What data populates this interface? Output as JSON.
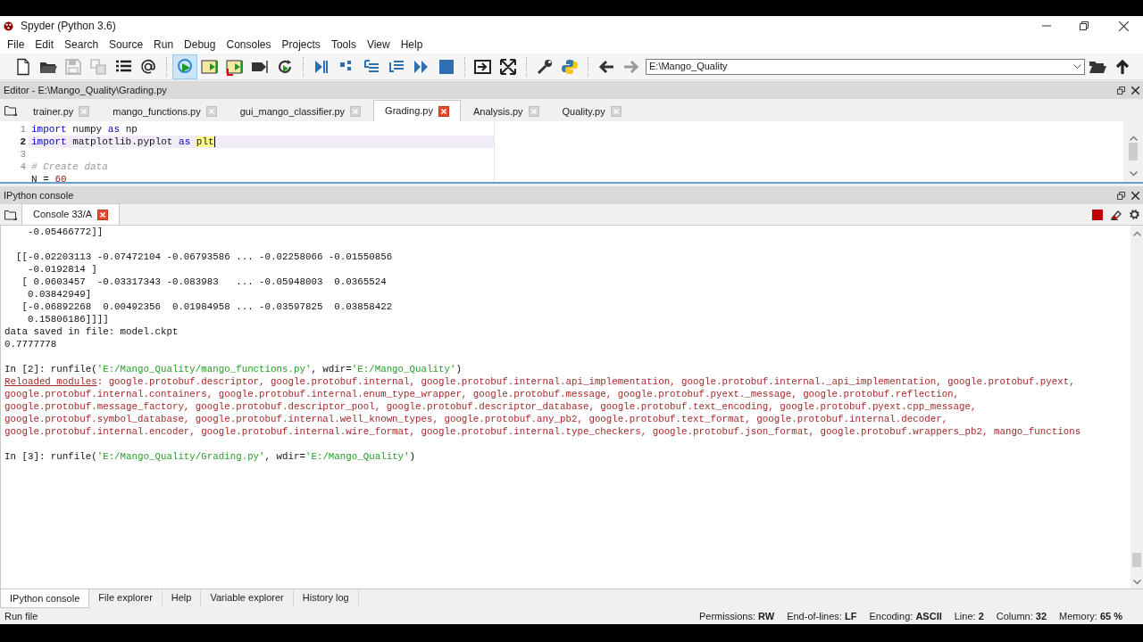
{
  "window": {
    "title": "Spyder (Python 3.6)"
  },
  "menu": [
    "File",
    "Edit",
    "Search",
    "Source",
    "Run",
    "Debug",
    "Consoles",
    "Projects",
    "Tools",
    "View",
    "Help"
  ],
  "path_field": {
    "value": "E:\\Mango_Quality"
  },
  "editor": {
    "title": "Editor - E:\\Mango_Quality\\Grading.py",
    "tabs": [
      {
        "label": "trainer.py",
        "selected": false
      },
      {
        "label": "mango_functions.py",
        "selected": false
      },
      {
        "label": "gui_mango_classifier.py",
        "selected": false
      },
      {
        "label": "Grading.py",
        "selected": true
      },
      {
        "label": "Analysis.py",
        "selected": false
      },
      {
        "label": "Quality.py",
        "selected": false
      }
    ],
    "lines": [
      {
        "number": "1",
        "current": false,
        "code": [
          {
            "kind": "keyword",
            "text": "import"
          },
          {
            "kind": "plain",
            "text": " numpy "
          },
          {
            "kind": "keyword",
            "text": "as"
          },
          {
            "kind": "plain",
            "text": " np"
          }
        ]
      },
      {
        "number": "2",
        "current": true,
        "code": [
          {
            "kind": "keyword",
            "text": "import"
          },
          {
            "kind": "plain",
            "text": " matplotlib.pyplot "
          },
          {
            "kind": "keyword",
            "text": "as "
          },
          {
            "kind": "match",
            "text": "plt"
          }
        ]
      },
      {
        "number": "3",
        "current": false
      },
      {
        "number": "4",
        "current": false,
        "code": [
          {
            "kind": "comment",
            "text": "# Create data"
          }
        ]
      },
      {
        "current": false,
        "code": [
          {
            "kind": "plain",
            "text": "N = "
          },
          {
            "kind": "number",
            "text": "60"
          }
        ]
      }
    ]
  },
  "console": {
    "title": "IPython console",
    "tabs": [
      {
        "label": "Console 33/A",
        "selected": true
      }
    ],
    "lines": [
      {
        "kind": "text",
        "segments": [
          {
            "kind": "plain",
            "text": "    -0.05466772]]"
          }
        ]
      },
      {
        "kind": "blank"
      },
      {
        "kind": "text",
        "segments": [
          {
            "kind": "plain",
            "text": "  [[-0.02203113 -0.07472104 -0.06793586 ... -0.02258066 -0.01550856"
          }
        ]
      },
      {
        "kind": "text",
        "segments": [
          {
            "kind": "plain",
            "text": "    -0.0192814 ]"
          }
        ]
      },
      {
        "kind": "text",
        "segments": [
          {
            "kind": "plain",
            "text": "   [ 0.0603457  -0.03317343 -0.083983   ... -0.05948003  0.0365524"
          }
        ]
      },
      {
        "kind": "text",
        "segments": [
          {
            "kind": "plain",
            "text": "    0.03842949]"
          }
        ]
      },
      {
        "kind": "text",
        "segments": [
          {
            "kind": "plain",
            "text": "   [-0.06892268  0.00492356  0.01984958 ... -0.03597825  0.03858422"
          }
        ]
      },
      {
        "kind": "text",
        "segments": [
          {
            "kind": "plain",
            "text": "    0.15806186]]]]"
          }
        ]
      },
      {
        "kind": "text",
        "segments": [
          {
            "kind": "plain",
            "text": "data saved in file: model.ckpt"
          }
        ]
      },
      {
        "kind": "text",
        "segments": [
          {
            "kind": "plain",
            "text": "0.7777778"
          }
        ]
      },
      {
        "kind": "blank"
      },
      {
        "kind": "prompt",
        "segments": [
          {
            "kind": "plain",
            "text": "In [2]: runfile("
          },
          {
            "kind": "string",
            "text": "'E:/Mango_Quality/mango_functions.py'"
          },
          {
            "kind": "plain",
            "text": ", wdir="
          },
          {
            "kind": "string",
            "text": "'E:/Mango_Quality'"
          },
          {
            "kind": "plain",
            "text": ")"
          }
        ]
      },
      {
        "kind": "error",
        "segments": [
          {
            "kind": "error_link",
            "text": "Reloaded modules"
          },
          {
            "kind": "error",
            "text": ": google.protobuf.descriptor, google.protobuf.internal, google.protobuf.internal.api_implementation, google.protobuf.internal._api_implementation, google.protobuf.pyext,"
          }
        ]
      },
      {
        "kind": "error",
        "segments": [
          {
            "kind": "error",
            "text": "google.protobuf.internal.containers, google.protobuf.internal.enum_type_wrapper, google.protobuf.message, google.protobuf.pyext._message, google.protobuf.reflection,"
          }
        ]
      },
      {
        "kind": "error",
        "segments": [
          {
            "kind": "error",
            "text": "google.protobuf.message_factory, google.protobuf.descriptor_pool, google.protobuf.descriptor_database, google.protobuf.text_encoding, google.protobuf.pyext.cpp_message,"
          }
        ]
      },
      {
        "kind": "error",
        "segments": [
          {
            "kind": "error",
            "text": "google.protobuf.symbol_database, google.protobuf.internal.well_known_types, google.protobuf.any_pb2, google.protobuf.text_format, google.protobuf.internal.decoder,"
          }
        ]
      },
      {
        "kind": "error",
        "segments": [
          {
            "kind": "error",
            "text": "google.protobuf.internal.encoder, google.protobuf.internal.wire_format, google.protobuf.internal.type_checkers, google.protobuf.json_format, google.protobuf.wrappers_pb2, mango_functions"
          }
        ]
      },
      {
        "kind": "blank"
      },
      {
        "kind": "prompt",
        "segments": [
          {
            "kind": "plain",
            "text": "In [3]: runfile("
          },
          {
            "kind": "string",
            "text": "'E:/Mango_Quality/Grading.py'"
          },
          {
            "kind": "plain",
            "text": ", wdir="
          },
          {
            "kind": "string",
            "text": "'E:/Mango_Quality'"
          },
          {
            "kind": "plain",
            "text": ")"
          }
        ]
      }
    ]
  },
  "bottom_tabs": [
    {
      "label": "IPython console",
      "selected": true
    },
    {
      "label": "File explorer",
      "selected": false
    },
    {
      "label": "Help",
      "selected": false
    },
    {
      "label": "Variable explorer",
      "selected": false
    },
    {
      "label": "History log",
      "selected": false
    }
  ],
  "status_bar": {
    "message": "Run file",
    "fields": [
      "Permissions: **RW**",
      "End-of-lines: **LF**",
      "Encoding: **ASCII**",
      "Line: **2**",
      "Column: **32**",
      "Memory: **65 %**"
    ]
  }
}
